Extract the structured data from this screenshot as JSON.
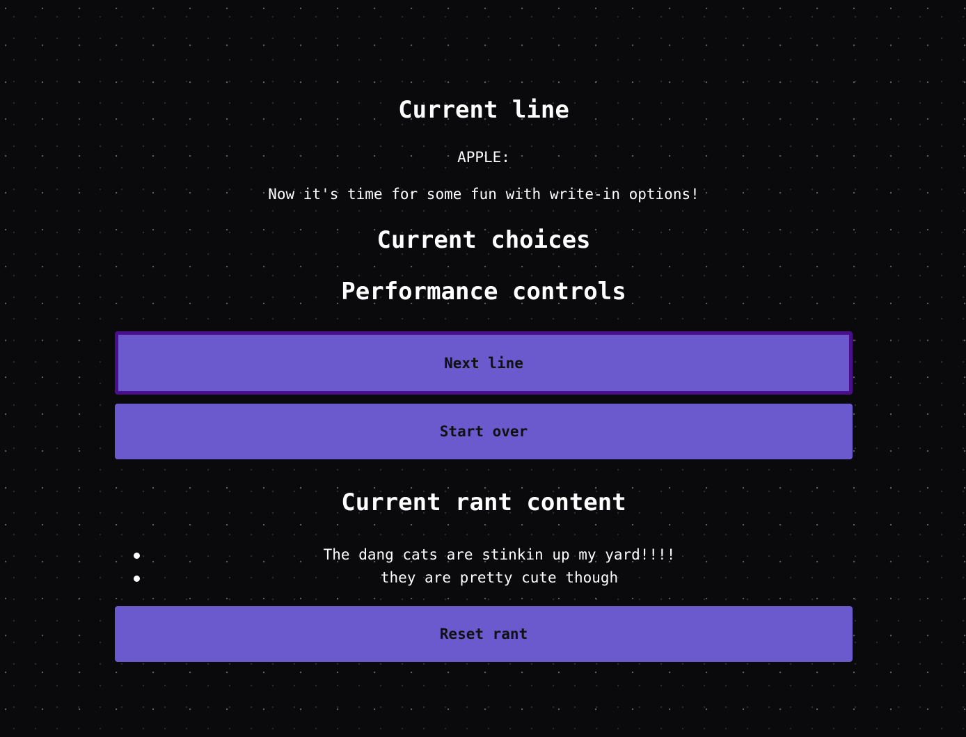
{
  "current_line": {
    "heading": "Current line",
    "speaker": "APPLE:",
    "text": "Now it's time for some fun with write-in options!"
  },
  "current_choices": {
    "heading": "Current choices"
  },
  "performance_controls": {
    "heading": "Performance controls",
    "next_line_label": "Next line",
    "start_over_label": "Start over"
  },
  "rant": {
    "heading": "Current rant content",
    "items": [
      "The dang cats are stinkin up my yard!!!!",
      "they are pretty cute though"
    ],
    "reset_label": "Reset rant"
  },
  "colors": {
    "background": "#0a0a0c",
    "button": "#6a5acd",
    "button_focus_border": "#4b0f8c",
    "text": "#ffffff"
  }
}
